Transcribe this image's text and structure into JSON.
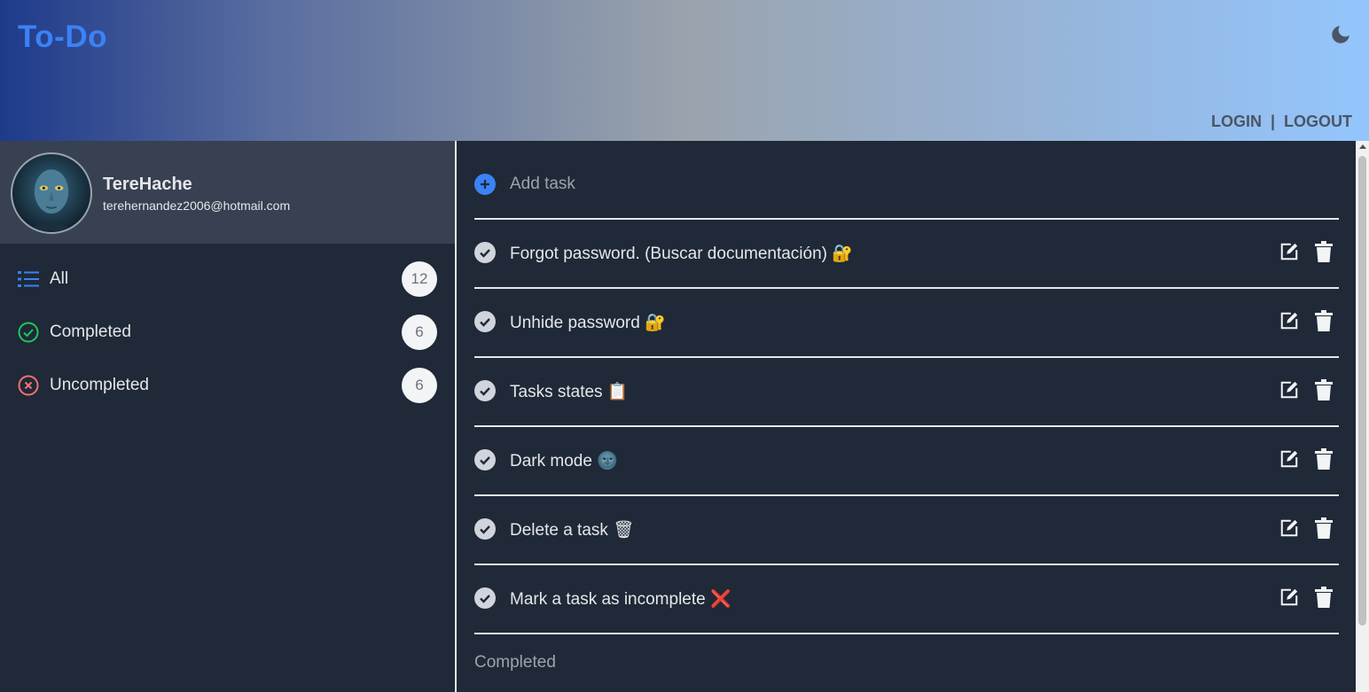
{
  "app": {
    "title": "To-Do"
  },
  "header": {
    "theme_icon": "moon-icon",
    "login": "LOGIN",
    "separator": "|",
    "logout": "LOGOUT"
  },
  "profile": {
    "name": "TereHache",
    "email": "terehernandez2006@hotmail.com"
  },
  "nav": {
    "items": [
      {
        "label": "All",
        "count": "12",
        "icon": "list-icon",
        "color": "#3b82f6"
      },
      {
        "label": "Completed",
        "count": "6",
        "icon": "check-circle-icon",
        "color": "#22c55e"
      },
      {
        "label": "Uncompleted",
        "count": "6",
        "icon": "x-circle-icon",
        "color": "#f87171"
      }
    ]
  },
  "add_task": {
    "label": "Add task",
    "icon": "plus-circle-icon",
    "color": "#3b82f6"
  },
  "tasks": [
    {
      "title": "Forgot password. (Buscar documentación) 🔐"
    },
    {
      "title": "Unhide password 🔐"
    },
    {
      "title": "Tasks states 📋"
    },
    {
      "title": "Dark mode 🌚"
    },
    {
      "title": "Delete a task 🗑"
    },
    {
      "title": "Mark a task as incomplete ❌"
    }
  ],
  "sections": {
    "completed_title": "Completed"
  },
  "colors": {
    "accent": "#3b82f6",
    "background": "#1f2937",
    "profile_bg": "#374151"
  }
}
